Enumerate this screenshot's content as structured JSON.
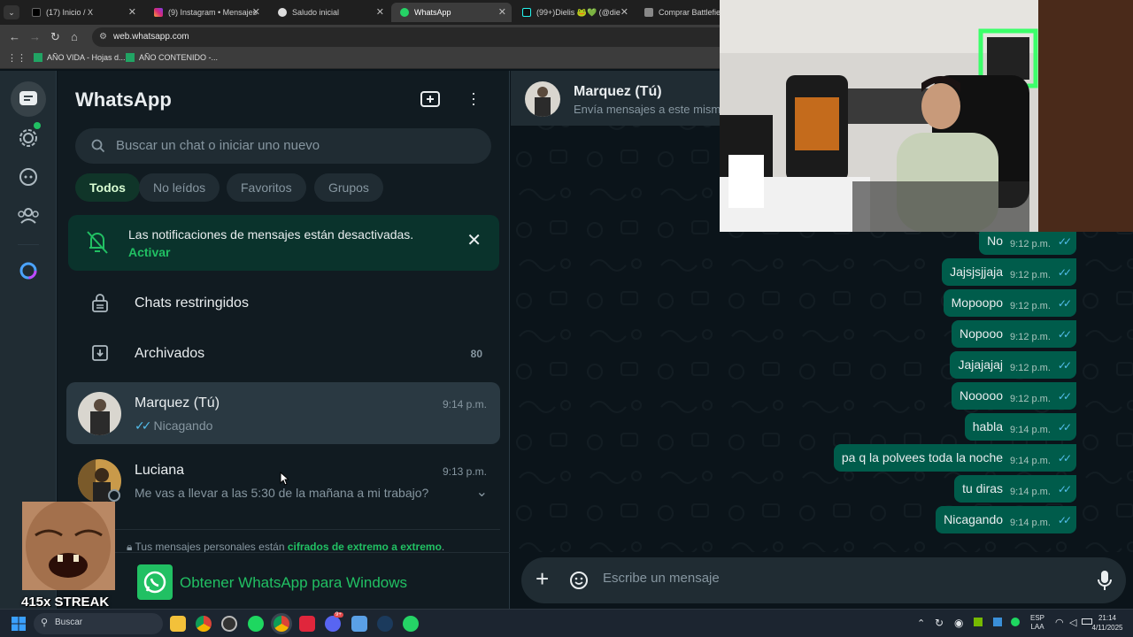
{
  "browser": {
    "tabs": [
      {
        "title": "(17) Inicio / X",
        "icon": "x-icon"
      },
      {
        "title": "(9) Instagram • Mensajes",
        "icon": "instagram-icon"
      },
      {
        "title": "Saludo inicial",
        "icon": "chatgpt-icon"
      },
      {
        "title": "WhatsApp",
        "icon": "whatsapp-icon",
        "active": true
      },
      {
        "title": "(99+)Dielis 🐸💚 (@die",
        "icon": "tiktok-icon"
      },
      {
        "title": "Comprar Battlefield™",
        "icon": "ea-icon"
      }
    ],
    "url": "web.whatsapp.com",
    "bookmarks": [
      "AÑO VIDA - Hojas d...",
      "AÑO CONTENIDO -..."
    ]
  },
  "sidebar": {
    "title": "WhatsApp",
    "search_placeholder": "Buscar un chat o iniciar uno nuevo",
    "filters": [
      "Todos",
      "No leídos",
      "Favoritos",
      "Grupos"
    ],
    "notification": {
      "text": "Las notificaciones de mensajes están desactivadas.",
      "link": "Activar"
    },
    "restricted_label": "Chats restringidos",
    "archived_label": "Archivados",
    "archived_count": "80",
    "chats": [
      {
        "name": "Marquez (Tú)",
        "time": "9:14 p.m.",
        "preview": "Nicagando",
        "read_ticks": "✓✓",
        "selected": true
      },
      {
        "name": "Luciana",
        "time": "9:13 p.m.",
        "preview": "Me vas a llevar a las 5:30 de la mañana a mi trabajo?"
      }
    ],
    "encryption_prefix": "Tus mensajes personales están ",
    "encryption_link": "cifrados de extremo a extremo",
    "encryption_suffix": ".",
    "get_app": "Obtener WhatsApp para Windows"
  },
  "conversation": {
    "name": "Marquez (Tú)",
    "subtitle": "Envía mensajes a este mismo",
    "messages": [
      {
        "text": "No",
        "time": "9:12 p.m."
      },
      {
        "text": "Jajsjsjjaja",
        "time": "9:12 p.m."
      },
      {
        "text": "Mopoopo",
        "time": "9:12 p.m."
      },
      {
        "text": "Nopooo",
        "time": "9:12 p.m."
      },
      {
        "text": "Jajajajaj",
        "time": "9:12 p.m."
      },
      {
        "text": "Nooooo",
        "time": "9:12 p.m."
      },
      {
        "text": "habla",
        "time": "9:14 p.m."
      },
      {
        "text": "pa q la polvees toda la noche",
        "time": "9:14 p.m."
      },
      {
        "text": "tu diras",
        "time": "9:14 p.m."
      },
      {
        "text": "Nicagando",
        "time": "9:14 p.m."
      }
    ],
    "ticks": "✓✓",
    "composer_placeholder": "Escribe un mensaje"
  },
  "overlay": {
    "streak": "415x STREAK"
  },
  "taskbar": {
    "search": "Buscar",
    "lang_top": "ESP",
    "lang_bottom": "LAA",
    "time": "21:14",
    "date": "4/11/2025",
    "badge": "9+"
  },
  "colors": {
    "accent_green": "#21c063",
    "bubble_out": "#005c4b",
    "panel": "#111b21",
    "header": "#202c33",
    "read_tick": "#53bdeb"
  }
}
